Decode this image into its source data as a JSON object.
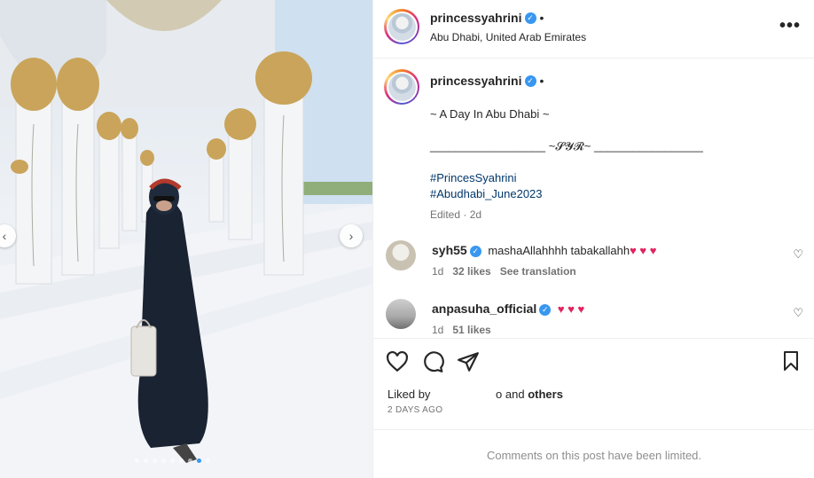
{
  "post_header": {
    "username": "princessyahrini",
    "location": "Abu Dhabi, United Arab Emirates",
    "more_label": "•••"
  },
  "caption": {
    "username": "princessyahrini",
    "line1": "~ A Day In Abu Dhabi ~",
    "line2": "__________________ ~𝓢𝓨𝓡~ _________________",
    "hashtag1": "#PrincesSyahrini",
    "hashtag2": "#Abudhabi_June2023",
    "edited": "Edited · 2d"
  },
  "comments": [
    {
      "username": "syh55",
      "text": "mashaAllahhhh tabakallahh",
      "emoji": "♥ ♥ ♥",
      "time": "1d",
      "likes": "32 likes",
      "translate": "See translation"
    },
    {
      "username": "anpasuha_official",
      "text": "",
      "emoji": "♥ ♥ ♥",
      "time": "1d",
      "likes": "51 likes"
    }
  ],
  "likes_info": {
    "prefix": "Liked by",
    "suffix": "o and",
    "others": "others",
    "time_ago": "2 DAYS AGO"
  },
  "footer": {
    "limited_text": "Comments on this post have been limited."
  },
  "carousel": {
    "dot_count": 9,
    "active_index": 7
  },
  "colors": {
    "accent": "#3897f0",
    "hashtag": "#00376b",
    "heart": "#e0245e",
    "muted": "#737373"
  }
}
